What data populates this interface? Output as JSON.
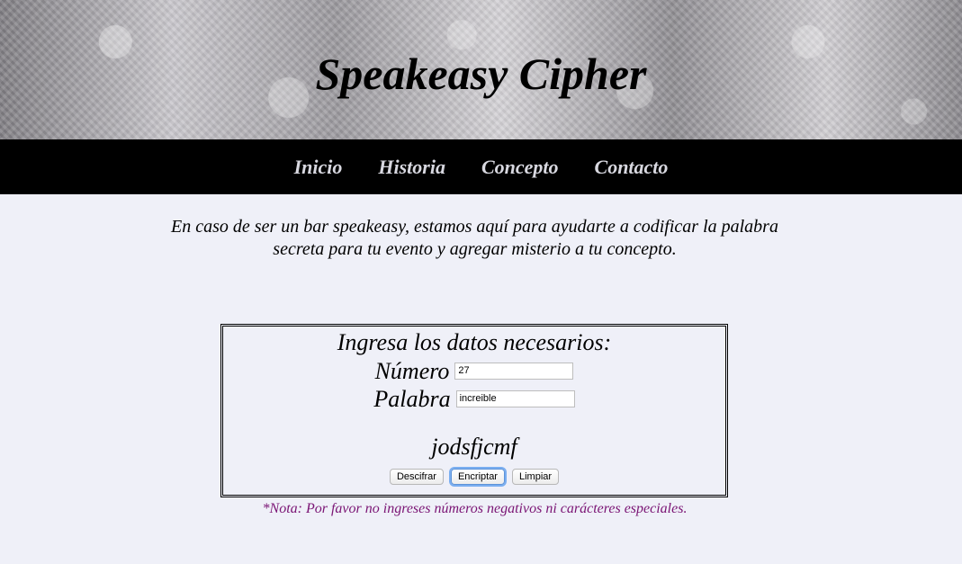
{
  "header": {
    "title": "Speakeasy Cipher"
  },
  "nav": {
    "items": [
      {
        "label": "Inicio"
      },
      {
        "label": "Historia"
      },
      {
        "label": "Concepto"
      },
      {
        "label": "Contacto"
      }
    ]
  },
  "intro": {
    "text": "En caso de ser un bar speakeasy, estamos aquí para ayudarte a codificar la palabra secreta para tu evento y agregar misterio a tu concepto."
  },
  "form": {
    "heading": "Ingresa los datos necesarios:",
    "number_label": "Número",
    "number_value": "27",
    "word_label": "Palabra",
    "word_value": "increible",
    "result": "jodsfjcmf",
    "buttons": {
      "decrypt": "Descifrar",
      "encrypt": "Encriptar",
      "clear": "Limpiar"
    }
  },
  "note": {
    "text": "*Nota: Por favor no ingreses números negativos ni carácteres especiales."
  },
  "colors": {
    "background": "#eff0f8",
    "nav_background": "#000000",
    "note": "#7a1474"
  }
}
